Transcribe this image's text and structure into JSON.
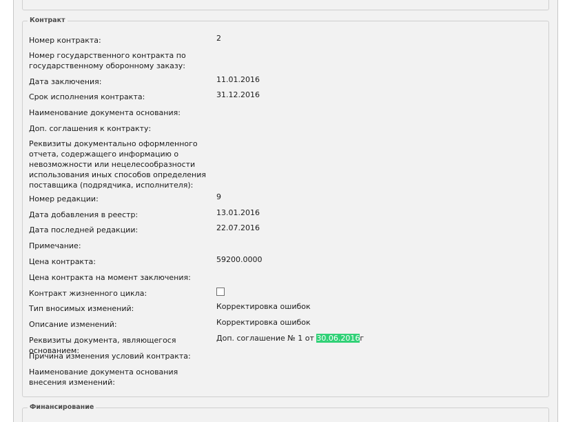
{
  "sections": {
    "contract": {
      "title": "Контракт"
    },
    "finance": {
      "title": "Финансирование"
    }
  },
  "rows": [
    {
      "label": "Номер контракта:",
      "value": "2"
    },
    {
      "label": "Номер государственного контракта по государственному оборонному заказу:",
      "value": ""
    },
    {
      "label": "Дата заключения:",
      "value": "11.01.2016"
    },
    {
      "label": "Срок исполнения контракта:",
      "value": "31.12.2016"
    },
    {
      "label": "Наименование документа основания:",
      "value": ""
    },
    {
      "label": "Доп. соглашения к контракту:",
      "value": ""
    },
    {
      "label": "Реквизиты документально оформленного отчета, содержащего информацию о невозможности или нецелесообразности использования иных способов определения поставщика (подрядчика, исполнителя):",
      "value": ""
    },
    {
      "label": "Номер редакции:",
      "value": "9"
    },
    {
      "label": "Дата добавления в реестр:",
      "value": "13.01.2016"
    },
    {
      "label": "Дата последней редакции:",
      "value": "22.07.2016"
    },
    {
      "label": "Примечание:",
      "value": ""
    },
    {
      "label": "Цена контракта:",
      "value": "59200.0000"
    },
    {
      "label": "Цена контракта на момент заключения:",
      "value": ""
    },
    {
      "label": "Контракт жизненного цикла:",
      "checked": false
    },
    {
      "label": "Тип вносимых изменений:",
      "value": "Корректировка ошибок"
    },
    {
      "label": "Описание изменений:",
      "value": "Корректировка ошибок"
    },
    {
      "label": "Реквизиты документа, являющегося основанием:",
      "value_prefix": "Доп. соглашение № 1 от ",
      "value_highlight": "30.06.2016",
      "value_suffix": "г"
    },
    {
      "label": "Причина изменения условий контракта:",
      "value": ""
    },
    {
      "label": "Наименование документа основания внесения изменений:",
      "value": ""
    }
  ],
  "colors": {
    "highlight": "#31d177",
    "panel_bg": "#f2f2f2",
    "border": "#cfcfcf"
  }
}
